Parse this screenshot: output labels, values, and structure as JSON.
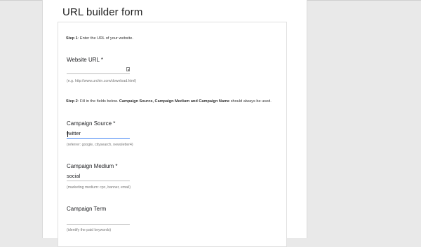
{
  "page": {
    "title": "URL builder form"
  },
  "step1": {
    "label": "Step 1",
    "text": ": Enter the URL of your website."
  },
  "website_url": {
    "label": "Website URL *",
    "value": "",
    "help": "(e.g. http://www.urchin.com/download.html)"
  },
  "step2": {
    "label": "Step 2",
    "text_a": ": Fill in the fields below. ",
    "bold": "Campaign Source, Campaign Medium and Campaign Name",
    "text_b": " should always be used."
  },
  "campaign_source": {
    "label": "Campaign Source *",
    "value": "twitter",
    "help": "(referrer: google, citysearch, newsletter4)"
  },
  "campaign_medium": {
    "label": "Campaign Medium *",
    "value": "social",
    "help": "(marketing medium: cpc, banner, email)"
  },
  "campaign_term": {
    "label": "Campaign Term",
    "value": "",
    "help": "(identify the paid keywords)"
  },
  "icons": {
    "url_field_icon": "edit-icon"
  },
  "colors": {
    "focus_underline": "#4285f4",
    "page_bg": "#e9e9e9",
    "form_bg": "#ffffff"
  }
}
